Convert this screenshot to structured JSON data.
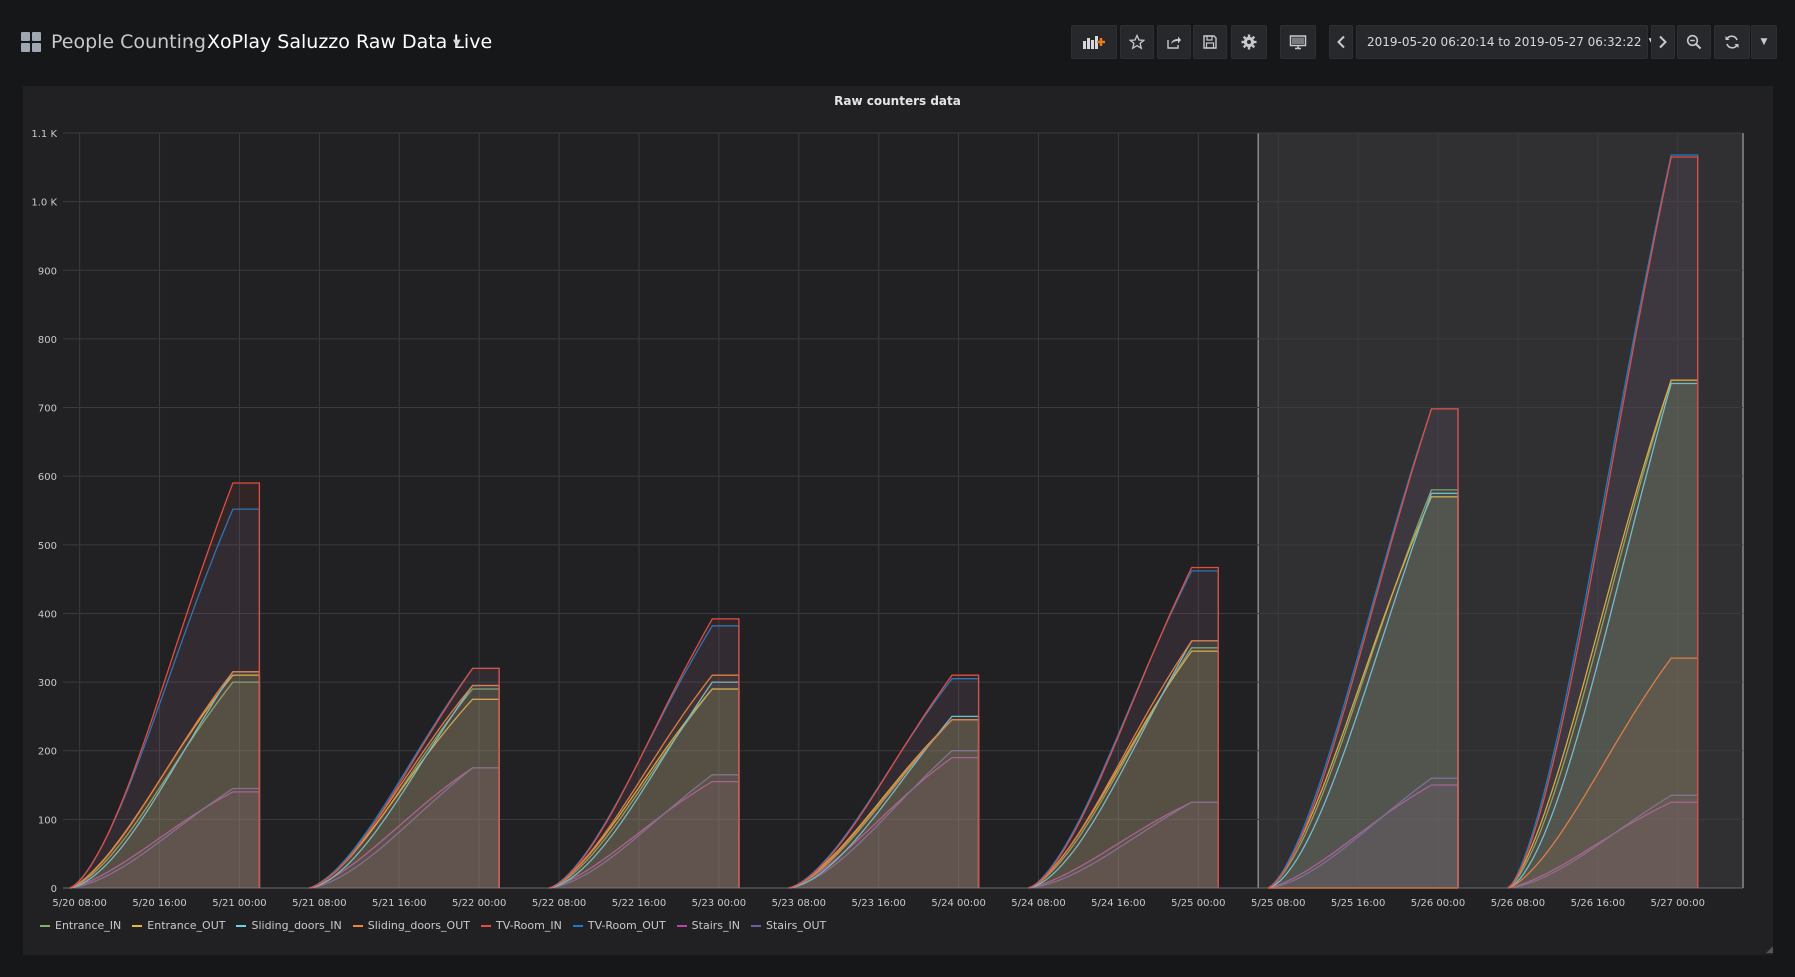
{
  "header": {
    "folder": "People Counting",
    "separator": "›",
    "title": "XoPlay Saluzzo Raw Data Live",
    "time_range": "2019-05-20 06:20:14 to 2019-05-27 06:32:22"
  },
  "toolbar": {
    "icons": [
      "add-panel-icon",
      "star-icon",
      "share-icon",
      "save-icon",
      "settings-icon",
      "tv-mode-icon",
      "time-back-icon",
      "clock-icon",
      "time-forward-icon",
      "zoom-out-icon",
      "refresh-icon",
      "refresh-interval-caret-icon"
    ]
  },
  "colors": {
    "Entrance_IN": "#7eb26d",
    "Entrance_OUT": "#eab839",
    "Sliding_doors_IN": "#6ed0e0",
    "Sliding_doors_OUT": "#ef843c",
    "TV-Room_IN": "#e24d42",
    "TV-Room_OUT": "#1f78c1",
    "Stairs_IN": "#ba43a9",
    "Stairs_OUT": "#705da0"
  },
  "chart_data": {
    "type": "area",
    "title": "Raw counters data",
    "x_range": [
      "2019-05-20 06:20",
      "2019-05-27 06:32"
    ],
    "x_tick_labels": [
      "5/20 08:00",
      "5/20 16:00",
      "5/21 00:00",
      "5/21 08:00",
      "5/21 16:00",
      "5/22 00:00",
      "5/22 08:00",
      "5/22 16:00",
      "5/23 00:00",
      "5/23 08:00",
      "5/23 16:00",
      "5/24 00:00",
      "5/24 08:00",
      "5/24 16:00",
      "5/25 00:00",
      "5/25 08:00",
      "5/25 16:00",
      "5/26 00:00",
      "5/26 08:00",
      "5/26 16:00",
      "5/27 00:00"
    ],
    "y_tick_labels": [
      "0",
      "100",
      "200",
      "300",
      "400",
      "500",
      "600",
      "700",
      "800",
      "900",
      "1.0 K",
      "1.1 K"
    ],
    "ylim": [
      0,
      1100
    ],
    "grid": true,
    "legend_position": "bottom",
    "highlight_region": [
      "2019-05-25 06:00",
      "2019-05-27 06:32"
    ],
    "days": [
      {
        "start": "2019-05-20 07:00",
        "end": "2019-05-21 02:00"
      },
      {
        "start": "2019-05-21 07:00",
        "end": "2019-05-22 02:00"
      },
      {
        "start": "2019-05-22 07:00",
        "end": "2019-05-23 02:00"
      },
      {
        "start": "2019-05-23 07:00",
        "end": "2019-05-24 02:00"
      },
      {
        "start": "2019-05-24 07:00",
        "end": "2019-05-25 02:00"
      },
      {
        "start": "2019-05-25 07:00",
        "end": "2019-05-26 02:00"
      },
      {
        "start": "2019-05-26 07:00",
        "end": "2019-05-27 02:00"
      }
    ],
    "series": [
      {
        "name": "Entrance_IN",
        "daily_totals": [
          300,
          290,
          290,
          245,
          350,
          580,
          740
        ]
      },
      {
        "name": "Entrance_OUT",
        "daily_totals": [
          310,
          275,
          290,
          245,
          345,
          570,
          740
        ]
      },
      {
        "name": "Sliding_doors_IN",
        "daily_totals": [
          315,
          295,
          300,
          250,
          360,
          575,
          735
        ]
      },
      {
        "name": "Sliding_doors_OUT",
        "daily_totals": [
          315,
          295,
          310,
          245,
          360,
          0,
          335
        ]
      },
      {
        "name": "TV-Room_IN",
        "daily_totals": [
          590,
          320,
          392,
          310,
          467,
          698,
          1065
        ]
      },
      {
        "name": "TV-Room_OUT",
        "daily_totals": [
          552,
          320,
          382,
          305,
          462,
          698,
          1068
        ]
      },
      {
        "name": "Stairs_IN",
        "daily_totals": [
          140,
          175,
          155,
          190,
          125,
          150,
          125
        ]
      },
      {
        "name": "Stairs_OUT",
        "daily_totals": [
          145,
          175,
          165,
          200,
          125,
          160,
          135
        ]
      }
    ]
  }
}
